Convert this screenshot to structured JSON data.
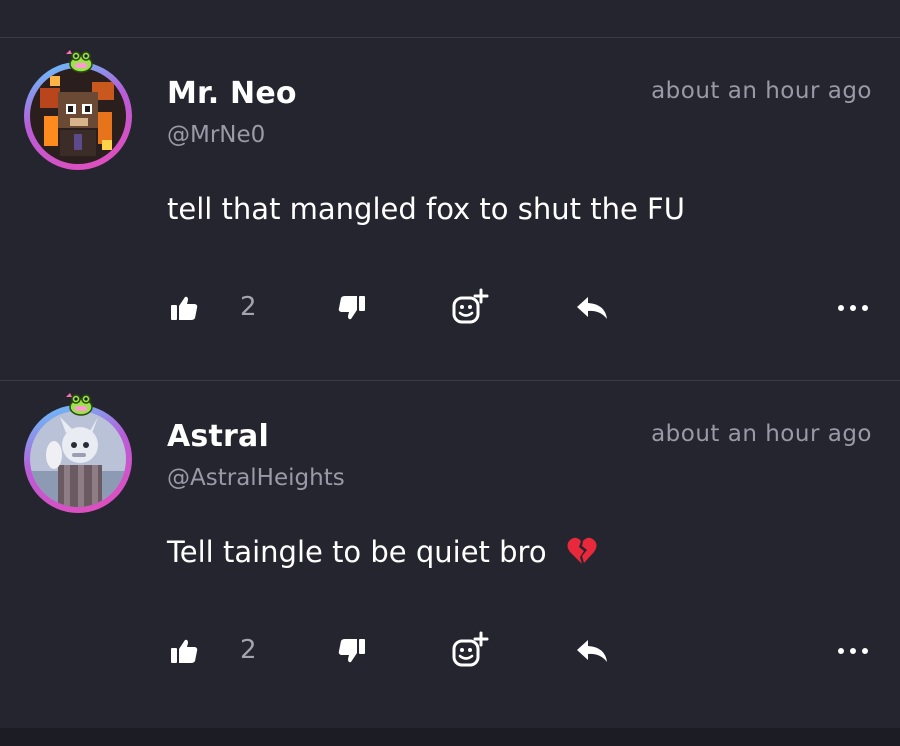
{
  "comments": [
    {
      "name": "Mr. Neo",
      "handle": "@MrNe0",
      "timestamp": "about an hour ago",
      "body": "tell that mangled fox to shut the FU",
      "likes": "2"
    },
    {
      "name": "Astral",
      "handle": "@AstralHeights",
      "timestamp": "about an hour ago",
      "body": "Tell taingle to be quiet bro",
      "body_emoji": "broken-heart-icon",
      "likes": "2"
    }
  ],
  "colors": {
    "background": "#252530",
    "divider": "#3a3a46",
    "secondary_text": "#9a9aa6",
    "ring_accent": "#e64bb8",
    "frog_badge": "#9be34a"
  },
  "icons": {
    "like": "thumbs-up-icon",
    "dislike": "thumbs-down-icon",
    "react": "add-reaction-icon",
    "reply": "reply-arrow-icon",
    "more": "more-dots-icon",
    "badge": "frog-badge-icon"
  }
}
